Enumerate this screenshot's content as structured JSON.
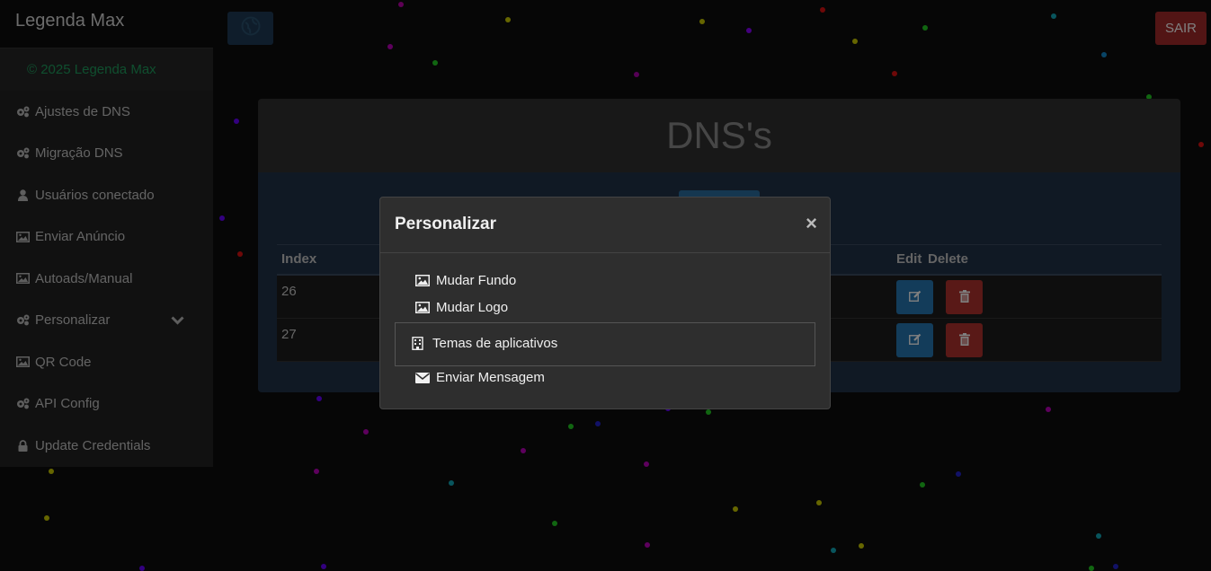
{
  "sidebar": {
    "brand": "Legenda Max",
    "copyright": "© 2025 Legenda Max",
    "items": [
      {
        "label": "Ajustes de DNS",
        "icon": "cogs-icon"
      },
      {
        "label": "Migração DNS",
        "icon": "cogs-icon"
      },
      {
        "label": "Usuários conectado",
        "icon": "user-icon"
      },
      {
        "label": "Enviar Anúncio",
        "icon": "image-icon"
      },
      {
        "label": "Autoads/Manual",
        "icon": "image-icon"
      },
      {
        "label": "Personalizar",
        "icon": "cogs-icon"
      },
      {
        "label": "QR Code",
        "icon": "image-icon"
      },
      {
        "label": "API Config",
        "icon": "cogs-icon"
      },
      {
        "label": "Update Credentials",
        "icon": "lock-icon"
      }
    ]
  },
  "topbar": {
    "logout_label": "SAIR"
  },
  "main": {
    "title": "DNS's",
    "table": {
      "headers": {
        "index": "Index",
        "edit": "Edit",
        "delete": "Delete"
      },
      "rows": [
        {
          "index": "26"
        },
        {
          "index": "27"
        }
      ]
    }
  },
  "modal": {
    "title": "Personalizar",
    "close": "×",
    "options": [
      {
        "label": "Mudar Fundo",
        "icon": "image-icon"
      },
      {
        "label": "Mudar Logo",
        "icon": "image-icon"
      },
      {
        "label": "Temas de aplicativos",
        "icon": "building-icon"
      },
      {
        "label": "Enviar Mensagem",
        "icon": "envelope-icon"
      }
    ]
  },
  "colors": {
    "accent_green": "#1f9e5e",
    "logout_red": "#a52a2a",
    "edit_blue": "#2778b4",
    "delete_red": "#b3332f",
    "panel_blue": "#213249"
  }
}
